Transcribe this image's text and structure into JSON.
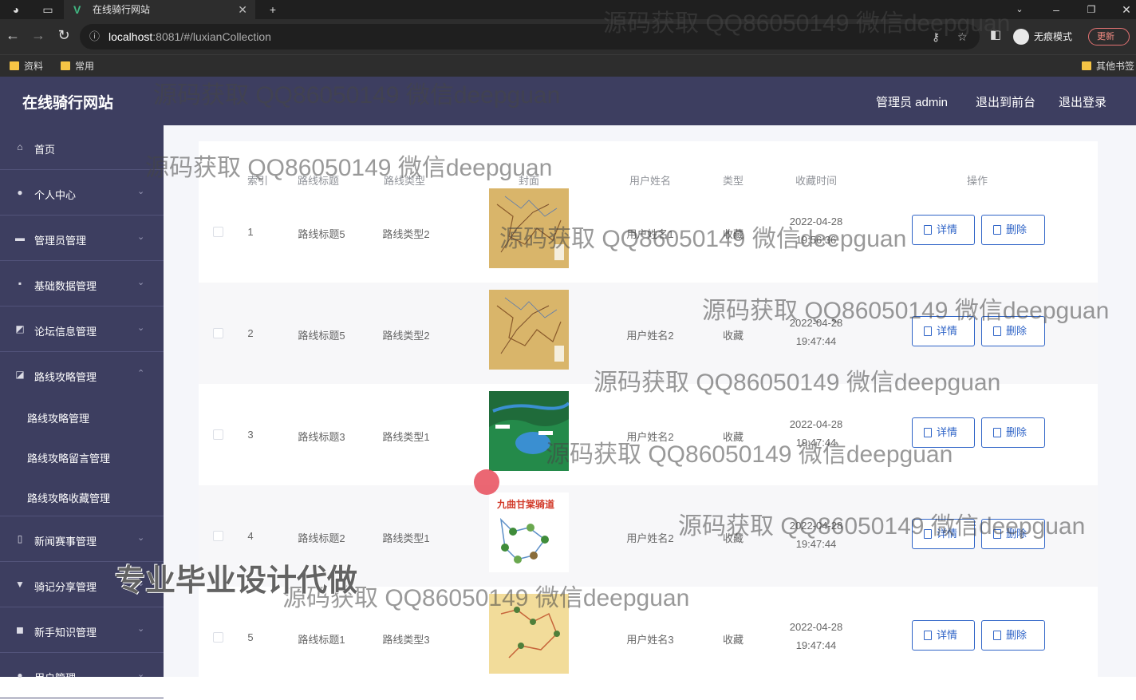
{
  "browser": {
    "tab_title": "在线骑行网站",
    "url_host": "localhost",
    "url_rest": ":8081/#/luxianCollection",
    "incognito_label": "无痕模式",
    "update_label": "更新",
    "bookmarks": [
      "资料",
      "常用"
    ],
    "other_bookmarks": "其他书签"
  },
  "header": {
    "title": "在线骑行网站",
    "admin_label": "管理员 admin",
    "front_label": "退出到前台",
    "logout_label": "退出登录"
  },
  "sidebar": {
    "items": [
      {
        "label": "首页",
        "icon": "home-icon"
      },
      {
        "label": "个人中心",
        "icon": "user-icon"
      },
      {
        "label": "管理员管理",
        "icon": "monitor-icon"
      },
      {
        "label": "基础数据管理",
        "icon": "chat-icon"
      },
      {
        "label": "论坛信息管理",
        "icon": "chart-icon"
      },
      {
        "label": "路线攻略管理",
        "icon": "wallet-icon"
      },
      {
        "label": "新闻赛事管理",
        "icon": "phone-icon"
      },
      {
        "label": "骑记分享管理",
        "icon": "pin-icon"
      },
      {
        "label": "新手知识管理",
        "icon": "ticket-icon"
      },
      {
        "label": "用户管理",
        "icon": "users-icon"
      }
    ],
    "sub_items": [
      "路线攻略管理",
      "路线攻略留言管理",
      "路线攻略收藏管理"
    ]
  },
  "table": {
    "headers": [
      "索引",
      "路线标题",
      "路线类型",
      "封面",
      "用户姓名",
      "类型",
      "收藏时间",
      "操作"
    ],
    "rows": [
      {
        "index": "1",
        "title": "路线标题5",
        "type": "路线类型2",
        "user": "用户姓名1",
        "kind": "收藏",
        "date": "2022-04-28",
        "time": "19:56:36"
      },
      {
        "index": "2",
        "title": "路线标题5",
        "type": "路线类型2",
        "user": "用户姓名2",
        "kind": "收藏",
        "date": "2022-04-28",
        "time": "19:47:44"
      },
      {
        "index": "3",
        "title": "路线标题3",
        "type": "路线类型1",
        "user": "用户姓名2",
        "kind": "收藏",
        "date": "2022-04-28",
        "time": "19:47:44"
      },
      {
        "index": "4",
        "title": "路线标题2",
        "type": "路线类型1",
        "user": "用户姓名2",
        "kind": "收藏",
        "date": "2022-04-28",
        "time": "19:47:44"
      },
      {
        "index": "5",
        "title": "路线标题1",
        "type": "路线类型3",
        "user": "用户姓名3",
        "kind": "收藏",
        "date": "2022-04-28",
        "time": "19:47:44"
      }
    ],
    "detail_label": "详情",
    "delete_label": "删除",
    "thumb4_caption": "九曲甘棠骑道"
  },
  "watermarks": {
    "text": "源码获取 QQ86050149 微信deepguan",
    "big": "专业毕业设计代做"
  }
}
